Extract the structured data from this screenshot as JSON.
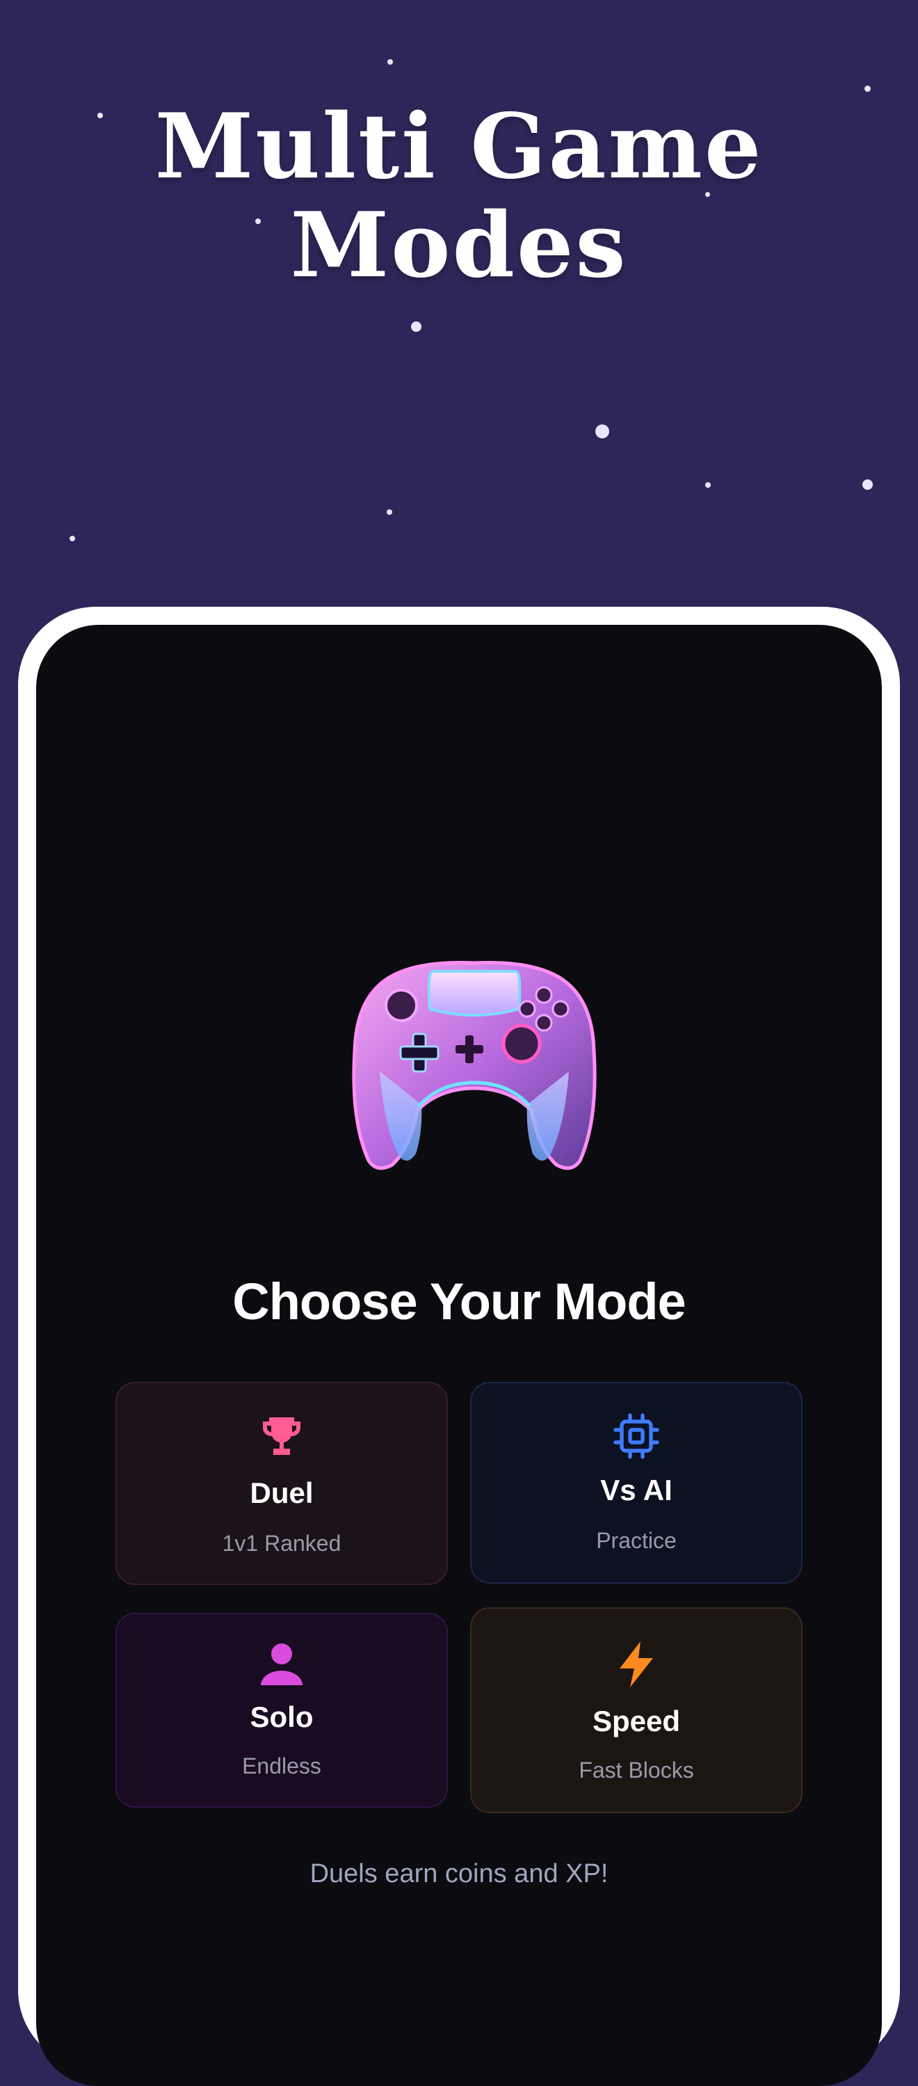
{
  "headline": {
    "line1": "Multi Game",
    "line2": "Modes"
  },
  "colors": {
    "background": "#2d2658",
    "screen": "#0b0b10",
    "duel_accent": "#ff5c93",
    "ai_accent": "#3f7bff",
    "solo_accent": "#d94dde",
    "speed_accent": "#ff8a1f"
  },
  "screen": {
    "title": "Choose Your Mode",
    "modes": [
      {
        "title": "Duel",
        "subtitle": "1v1 Ranked",
        "icon": "trophy-icon"
      },
      {
        "title": "Vs AI",
        "subtitle": "Practice",
        "icon": "cpu-chip-icon"
      },
      {
        "title": "Solo",
        "subtitle": "Endless",
        "icon": "person-icon"
      },
      {
        "title": "Speed",
        "subtitle": "Fast Blocks",
        "icon": "lightning-bolt-icon"
      }
    ],
    "footnote": "Duels earn coins and XP!"
  }
}
